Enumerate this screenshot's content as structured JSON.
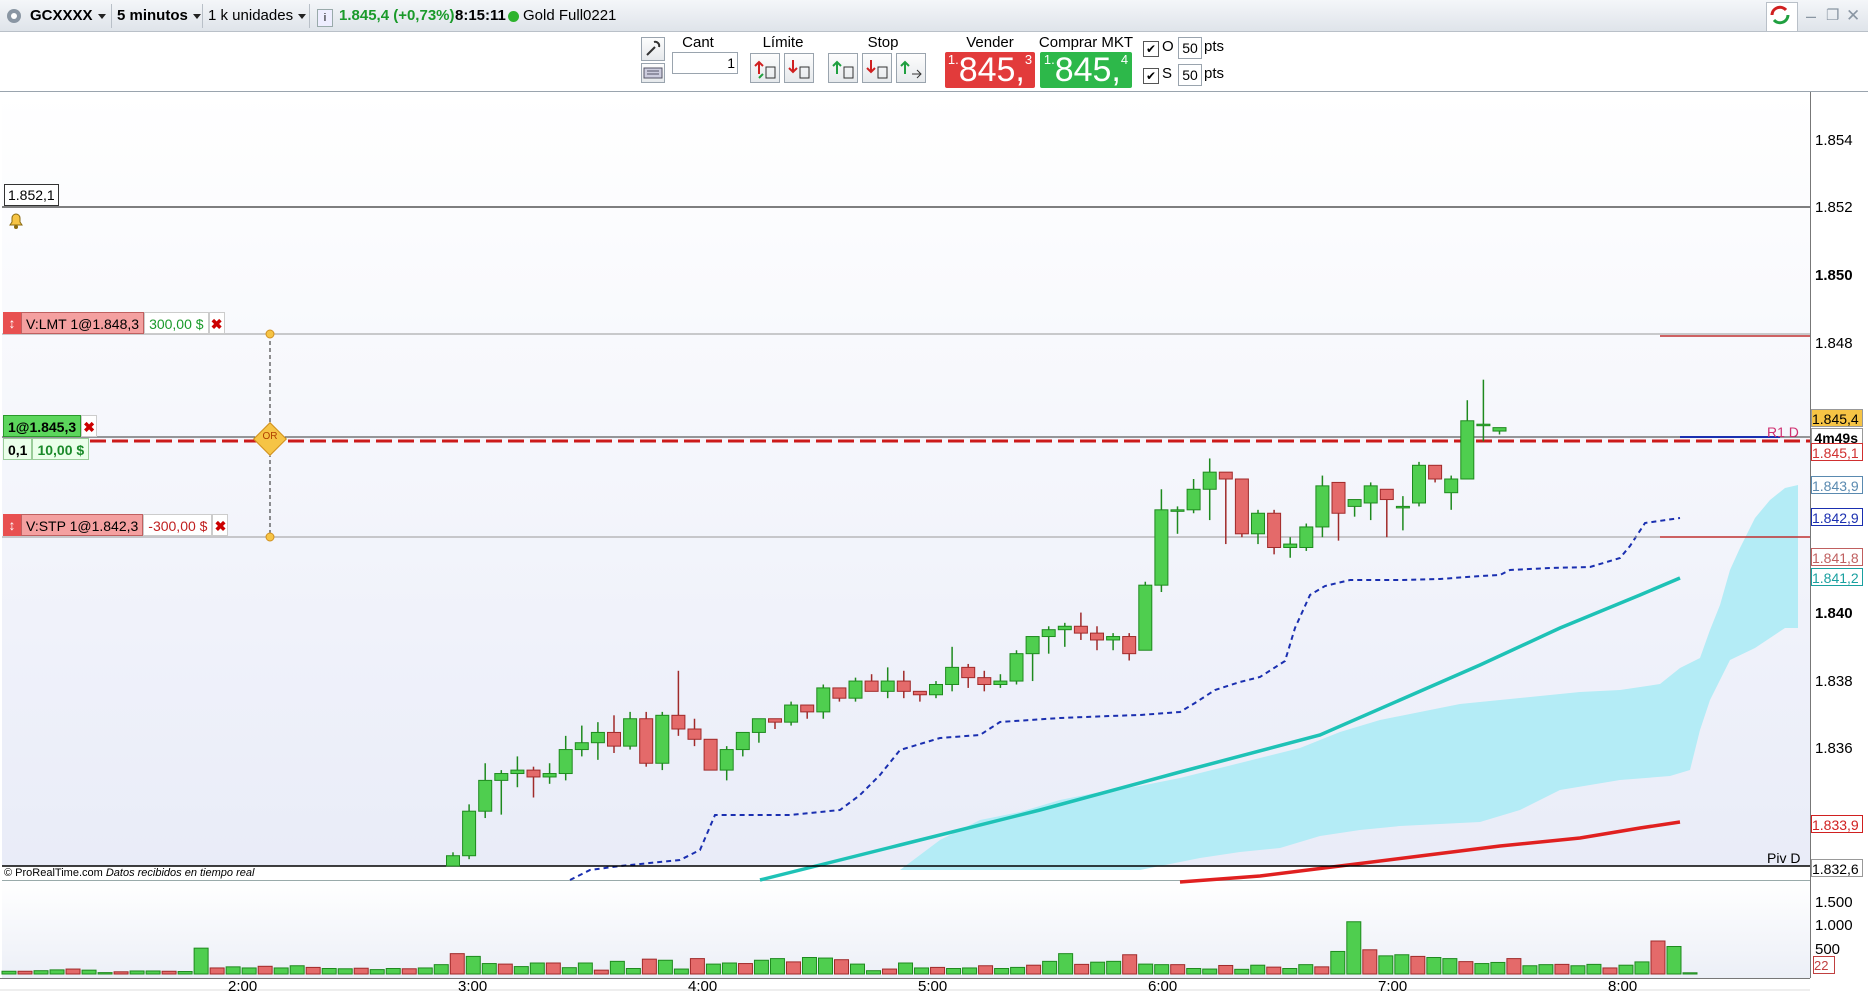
{
  "header": {
    "instrument": "GCXXXX",
    "timeframe": "5 minutos",
    "units": "1 k unidades",
    "quote": "1.845,4 (+0,73%)",
    "time": "8:15:11",
    "contract": "Gold Full0221"
  },
  "toolbar": {
    "cant_label": "Cant",
    "cant_value": "1",
    "limit_label": "Límite",
    "stop_label": "Stop",
    "sell_label": "Vender MKT",
    "buy_label": "Comprar MKT",
    "sell_price": {
      "pre": "1.",
      "main": "845,",
      "sup": "3"
    },
    "buy_price": {
      "pre": "1.",
      "main": "845,",
      "sup": "4"
    },
    "o_label": "O",
    "o_value": "50",
    "s_label": "S",
    "s_value": "50",
    "pts_label": "pts"
  },
  "orders": {
    "limit": {
      "label": "V:LMT 1@1.848,3",
      "pnl": "300,00 $"
    },
    "position": {
      "label": "1@1.845,3",
      "qty": "0,1",
      "pnl": "10,00 $"
    },
    "stop": {
      "label": "V:STP 1@1.842,3",
      "pnl": "-300,00 $"
    },
    "or_marker": "OR",
    "alert_price": "1.852,1"
  },
  "overlay": {
    "copyright": "© ProRealTime.com",
    "realtime": "Datos recibidos en tiempo real",
    "r1": "R1 D",
    "piv": "Piv D"
  },
  "axis": {
    "y_labels": [
      "1.854",
      "1.852",
      "1.850",
      "1.848",
      "1.840",
      "1.838",
      "1.836"
    ],
    "tags": [
      {
        "text": "1.845,4",
        "bg": "#f6c445",
        "fg": "#000"
      },
      {
        "text": "4m49s",
        "bg": "#ffffff",
        "fg": "#000"
      },
      {
        "text": "1.845,1",
        "bg": "#ffffff",
        "fg": "#d03030"
      },
      {
        "text": "1.843,9",
        "bg": "#ffffff",
        "fg": "#5a8ab0"
      },
      {
        "text": "1.842,9",
        "bg": "#ffffff",
        "fg": "#1a2fb0"
      },
      {
        "text": "1.841,8",
        "bg": "#ffffff",
        "fg": "#c06060"
      },
      {
        "text": "1.841,2",
        "bg": "#ffffff",
        "fg": "#1aa0a0"
      },
      {
        "text": "1.833,9",
        "bg": "#ffffff",
        "fg": "#d02020"
      },
      {
        "text": "1.832,6",
        "bg": "#ffffff",
        "fg": "#000"
      }
    ],
    "vol_labels": [
      "1.500",
      "1.000",
      "500"
    ],
    "vol_last": "22",
    "time_labels": [
      "2:00",
      "3:00",
      "4:00",
      "5:00",
      "6:00",
      "7:00",
      "8:00"
    ]
  },
  "chart_data": {
    "type": "candlestick",
    "ylim": [
      1832.6,
      1855.2
    ],
    "candles": [
      [
        1832.5,
        1832.9,
        1832.4,
        1833.0
      ],
      [
        1832.9,
        1834.2,
        1832.8,
        1834.4
      ],
      [
        1834.2,
        1835.1,
        1834.0,
        1835.6
      ],
      [
        1835.1,
        1835.3,
        1834.1,
        1835.4
      ],
      [
        1835.3,
        1835.4,
        1834.9,
        1835.8
      ],
      [
        1835.4,
        1835.2,
        1834.6,
        1835.5
      ],
      [
        1835.2,
        1835.3,
        1835.0,
        1835.6
      ],
      [
        1835.3,
        1836.0,
        1835.1,
        1836.4
      ],
      [
        1836.0,
        1836.2,
        1835.8,
        1836.7
      ],
      [
        1836.2,
        1836.5,
        1835.7,
        1836.8
      ],
      [
        1836.5,
        1836.1,
        1835.9,
        1837.0
      ],
      [
        1836.1,
        1836.9,
        1836.0,
        1837.1
      ],
      [
        1836.9,
        1835.6,
        1835.5,
        1837.1
      ],
      [
        1835.6,
        1837.0,
        1835.4,
        1837.1
      ],
      [
        1837.0,
        1836.6,
        1836.4,
        1838.3
      ],
      [
        1836.6,
        1836.3,
        1836.1,
        1836.9
      ],
      [
        1836.3,
        1835.4,
        1835.4,
        1836.3
      ],
      [
        1835.4,
        1836.0,
        1835.1,
        1836.1
      ],
      [
        1836.0,
        1836.5,
        1835.8,
        1836.5
      ],
      [
        1836.5,
        1836.9,
        1836.2,
        1836.9
      ],
      [
        1836.9,
        1836.8,
        1836.6,
        1836.9
      ],
      [
        1836.8,
        1837.3,
        1836.7,
        1837.4
      ],
      [
        1837.3,
        1837.1,
        1836.9,
        1837.3
      ],
      [
        1837.1,
        1837.8,
        1836.9,
        1837.9
      ],
      [
        1837.8,
        1837.5,
        1837.4,
        1837.8
      ],
      [
        1837.5,
        1838.0,
        1837.4,
        1838.1
      ],
      [
        1838.0,
        1837.7,
        1837.7,
        1838.2
      ],
      [
        1837.7,
        1838.0,
        1837.5,
        1838.4
      ],
      [
        1838.0,
        1837.7,
        1837.5,
        1838.3
      ],
      [
        1837.7,
        1837.6,
        1837.4,
        1837.7
      ],
      [
        1837.6,
        1837.9,
        1837.5,
        1838.0
      ],
      [
        1837.9,
        1838.4,
        1837.7,
        1839.0
      ],
      [
        1838.4,
        1838.1,
        1837.8,
        1838.5
      ],
      [
        1838.1,
        1837.9,
        1837.7,
        1838.3
      ],
      [
        1837.9,
        1838.0,
        1837.8,
        1838.2
      ],
      [
        1838.0,
        1838.8,
        1837.9,
        1838.9
      ],
      [
        1838.8,
        1839.3,
        1838.0,
        1839.3
      ],
      [
        1839.3,
        1839.5,
        1838.8,
        1839.6
      ],
      [
        1839.5,
        1839.6,
        1839.0,
        1839.7
      ],
      [
        1839.6,
        1839.4,
        1839.2,
        1840.0
      ],
      [
        1839.4,
        1839.2,
        1838.9,
        1839.6
      ],
      [
        1839.2,
        1839.3,
        1838.9,
        1839.4
      ],
      [
        1839.3,
        1838.8,
        1838.6,
        1839.4
      ],
      [
        1838.9,
        1840.8,
        1838.9,
        1840.9
      ],
      [
        1840.8,
        1843.0,
        1840.6,
        1843.6
      ],
      [
        1843.0,
        1843.0,
        1842.3,
        1843.1
      ],
      [
        1843.0,
        1843.6,
        1842.9,
        1843.9
      ],
      [
        1843.6,
        1844.1,
        1842.7,
        1844.5
      ],
      [
        1844.1,
        1843.9,
        1842.0,
        1844.1
      ],
      [
        1843.9,
        1842.3,
        1842.2,
        1843.9
      ],
      [
        1842.3,
        1842.9,
        1842.0,
        1843.0
      ],
      [
        1842.9,
        1841.9,
        1841.7,
        1843.0
      ],
      [
        1841.9,
        1842.0,
        1841.6,
        1842.2
      ],
      [
        1841.9,
        1842.5,
        1841.8,
        1842.6
      ],
      [
        1842.5,
        1843.7,
        1842.2,
        1844.0
      ],
      [
        1843.8,
        1842.9,
        1842.1,
        1843.8
      ],
      [
        1843.1,
        1843.3,
        1842.8,
        1843.3
      ],
      [
        1843.2,
        1843.7,
        1842.7,
        1843.8
      ],
      [
        1843.6,
        1843.3,
        1842.2,
        1843.6
      ],
      [
        1843.1,
        1843.1,
        1842.4,
        1843.4
      ],
      [
        1843.2,
        1844.3,
        1843.1,
        1844.4
      ],
      [
        1844.3,
        1843.9,
        1843.8,
        1844.2
      ],
      [
        1843.5,
        1843.9,
        1843.0,
        1844.0
      ],
      [
        1843.9,
        1845.6,
        1843.9,
        1846.2
      ],
      [
        1845.5,
        1845.5,
        1845.0,
        1846.8
      ],
      [
        1845.3,
        1845.4,
        1845.2,
        1845.4
      ]
    ],
    "volumes": [
      50,
      50,
      60,
      75,
      90,
      70,
      25,
      40,
      55,
      55,
      50,
      45,
      470,
      110,
      130,
      110,
      140,
      110,
      150,
      120,
      100,
      95,
      105,
      80,
      100,
      95,
      110,
      170,
      370,
      320,
      190,
      180,
      135,
      200,
      200,
      115,
      200,
      70,
      230,
      100,
      270,
      250,
      90,
      280,
      180,
      200,
      190,
      250,
      280,
      220,
      300,
      290,
      260,
      180,
      60,
      90,
      200,
      110,
      120,
      100,
      110,
      150,
      100,
      120,
      160,
      230,
      370,
      175,
      215,
      230,
      350,
      180,
      170,
      170,
      100,
      90,
      155,
      85,
      160,
      125,
      100,
      170,
      130,
      410,
      950,
      440,
      330,
      350,
      320,
      300,
      280,
      225,
      190,
      210,
      280,
      150,
      170,
      175,
      150,
      175,
      110,
      160,
      220,
      600,
      500,
      22
    ]
  }
}
